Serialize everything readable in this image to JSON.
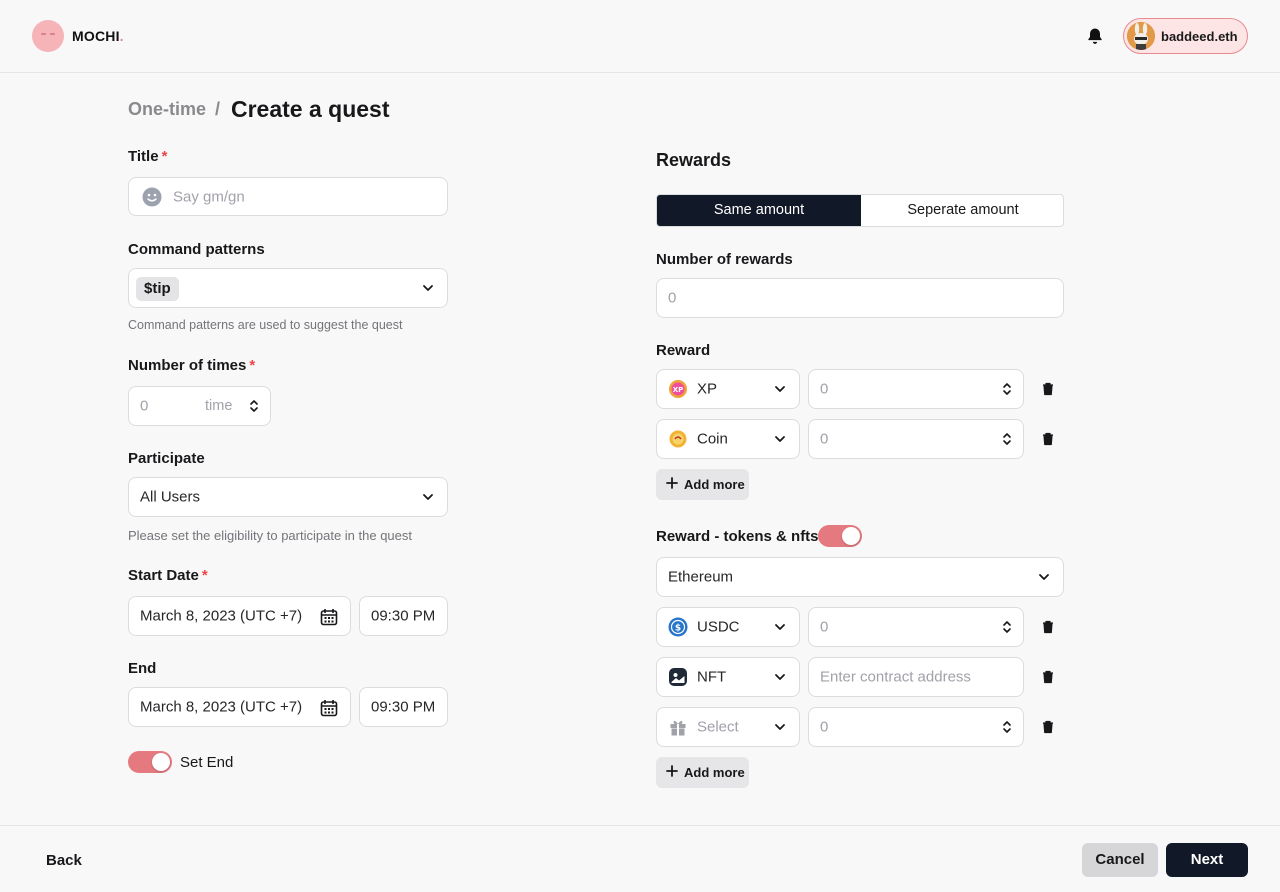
{
  "header": {
    "logo_text": "MOCHI",
    "logo_dot": ".",
    "username": "baddeed.eth",
    "accent_color": "#e88a90"
  },
  "breadcrumb": {
    "parent": "One-time",
    "separator": "/",
    "title": "Create a quest"
  },
  "form": {
    "title_label": "Title",
    "title_placeholder": "Say gm/gn",
    "command_label": "Command patterns",
    "command_tag": "$tip",
    "command_hint": "Command patterns are used to suggest the quest",
    "times_label": "Number of times",
    "times_value": "0",
    "times_unit": "time",
    "participate_label": "Participate",
    "participate_value": "All Users",
    "participate_hint": "Please set the eligibility to participate in the quest",
    "start_label": "Start Date",
    "start_date": "March 8, 2023 (UTC +7)",
    "start_time": "09:30 PM",
    "end_label": "End",
    "end_date": "March 8, 2023 (UTC +7)",
    "end_time": "09:30 PM",
    "set_end_label": "Set End",
    "required_mark": "*"
  },
  "rewards": {
    "title": "Rewards",
    "segment_same": "Same amount",
    "segment_separate": "Seperate amount",
    "count_label": "Number of rewards",
    "count_placeholder": "0",
    "reward_label": "Reward",
    "reward_rows": [
      {
        "type": "XP",
        "icon": "xp-icon",
        "amount": "0"
      },
      {
        "type": "Coin",
        "icon": "coin-icon",
        "amount": "0"
      }
    ],
    "add_more": "Add more",
    "tokens_label": "Reward - tokens & nfts",
    "chain": "Ethereum",
    "token_rows": [
      {
        "type": "USDC",
        "icon": "usdc-icon",
        "amount": "0"
      },
      {
        "type": "NFT",
        "icon": "nft-icon",
        "amount": "Enter contract address"
      },
      {
        "type": "Select",
        "icon": "gift-icon",
        "amount": "0"
      }
    ],
    "add_more_2": "Add more"
  },
  "footer": {
    "back": "Back",
    "cancel": "Cancel",
    "next": "Next"
  }
}
